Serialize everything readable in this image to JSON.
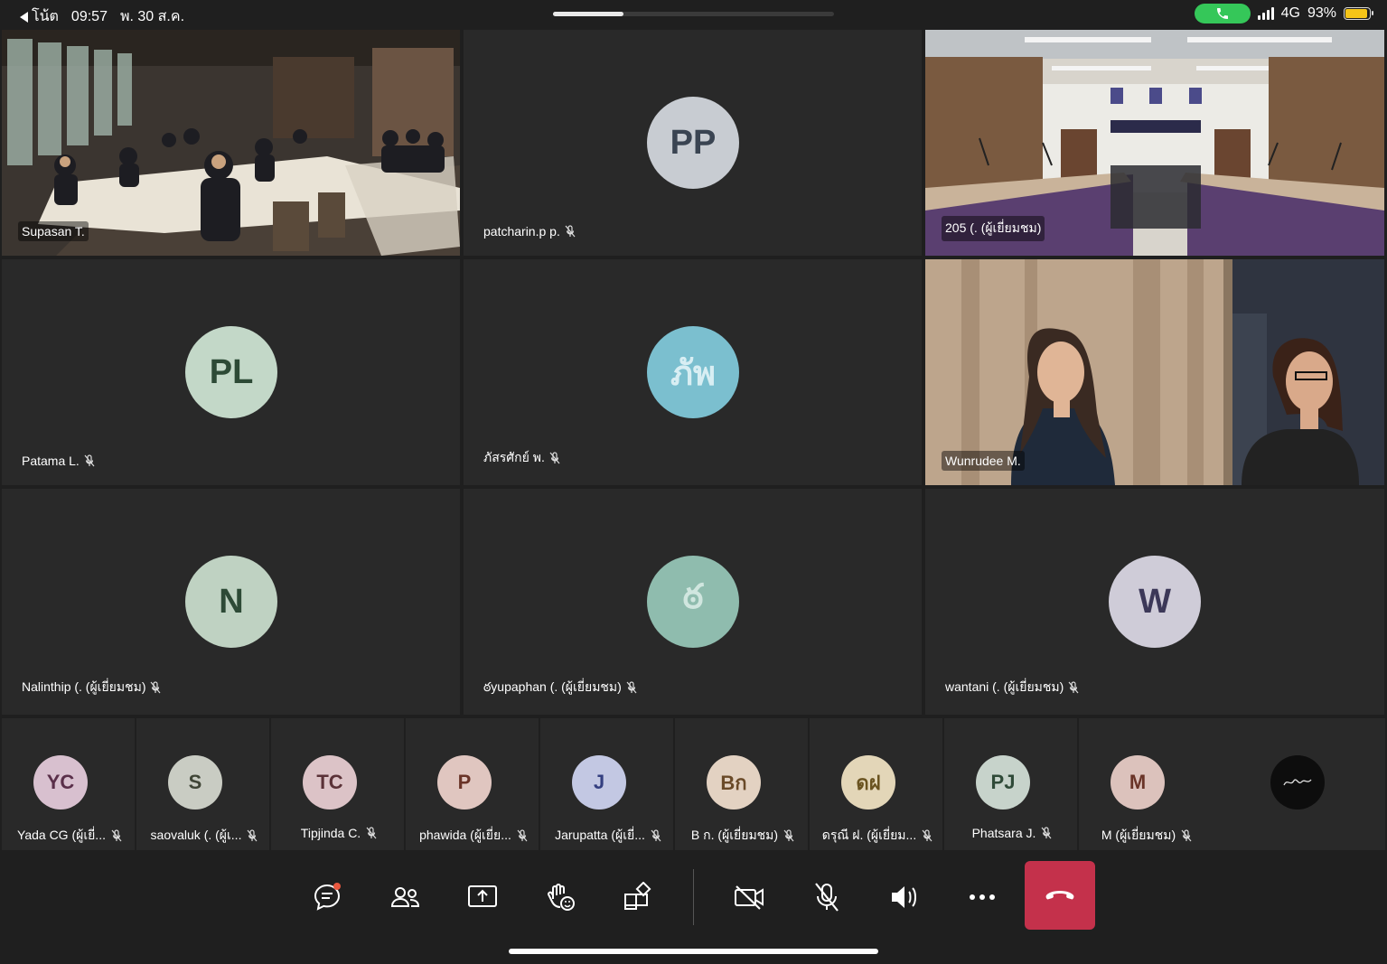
{
  "status_bar": {
    "back_label": "โน้ต",
    "time": "09:57",
    "date": "พ. 30 ส.ค.",
    "network": "4G",
    "battery": "93%",
    "battery_level": 0.93,
    "progress": 0.25
  },
  "tiles": [
    {
      "name": "Supasan T.",
      "muted": false,
      "video": "meeting-room",
      "active": true
    },
    {
      "name": "patcharin.p p.",
      "muted": true,
      "initials": "PP",
      "avatar_bg": "#c8ccd2",
      "avatar_fg": "#3a4452"
    },
    {
      "name": "205 (. (ผู้เยี่ยมชม)",
      "muted": false,
      "video": "conference-hall"
    },
    {
      "name": "Patama L.",
      "muted": true,
      "initials": "PL",
      "avatar_bg": "#c3d8c8",
      "avatar_fg": "#2d4a36"
    },
    {
      "name": "ภัสรศักย์ พ.",
      "muted": true,
      "initials": "ภัพ",
      "avatar_bg": "#7bbfcf",
      "avatar_fg": "#d8eef3"
    },
    {
      "name": "Wunrudee M.",
      "muted": false,
      "video": "two-women"
    },
    {
      "name": "Nalinthip (. (ผู้เยี่ยมชม)",
      "muted": true,
      "initials": "N",
      "avatar_bg": "#bfd2c2",
      "avatar_fg": "#2d4a36"
    },
    {
      "name": "ఠyupaphan (. (ผู้เยี่ยมชม)",
      "muted": true,
      "initials": "ఠ",
      "avatar_bg": "#8fbcae",
      "avatar_fg": "#d0e6df"
    },
    {
      "name": "wantani (. (ผู้เยี่ยมชม)",
      "muted": true,
      "initials": "W",
      "avatar_bg": "#cfccd8",
      "avatar_fg": "#3c3858"
    }
  ],
  "strip": [
    {
      "name": "Yada CG (ผู้เยี่...",
      "initials": "YC",
      "avatar_bg": "#d8c0cf",
      "avatar_fg": "#5a2f4a"
    },
    {
      "name": "saovaluk (. (ผู้เ...",
      "initials": "S",
      "avatar_bg": "#c9ccc3",
      "avatar_fg": "#3f4536"
    },
    {
      "name": "Tipjinda C.",
      "initials": "TC",
      "avatar_bg": "#dcc3c7",
      "avatar_fg": "#5b3238"
    },
    {
      "name": "phawida (ผู้เยี่ย...",
      "initials": "P",
      "avatar_bg": "#e0c6c0",
      "avatar_fg": "#6a3428"
    },
    {
      "name": "Jarupatta (ผู้เยี่...",
      "initials": "J",
      "avatar_bg": "#c3c8e3",
      "avatar_fg": "#343f80"
    },
    {
      "name": "B ก. (ผู้เยี่ยมชม)",
      "initials": "Bก",
      "avatar_bg": "#e3d2c2",
      "avatar_fg": "#6a4a28"
    },
    {
      "name": "ดรุณี ฝ. (ผู้เยี่ยม...",
      "initials": "ดฝ",
      "avatar_bg": "#e3d6b8",
      "avatar_fg": "#6a5320"
    },
    {
      "name": "Phatsara J.",
      "initials": "PJ",
      "avatar_bg": "#c7d3cb",
      "avatar_fg": "#2f4a38"
    },
    {
      "name": "M (ผู้เยี่ยมชม)",
      "initials": "M",
      "avatar_bg": "#dcc2bc",
      "avatar_fg": "#6a3428"
    }
  ],
  "toolbar": {
    "buttons": [
      "chat",
      "participants",
      "share",
      "react",
      "apps",
      "camera-off",
      "mic-off",
      "speaker",
      "more",
      "hang-up"
    ],
    "hangup_color": "#c4314b"
  },
  "colors": {
    "active_border": "#5b5fc7",
    "tile_bg": "#292929",
    "page_bg": "#1f1f1f"
  }
}
